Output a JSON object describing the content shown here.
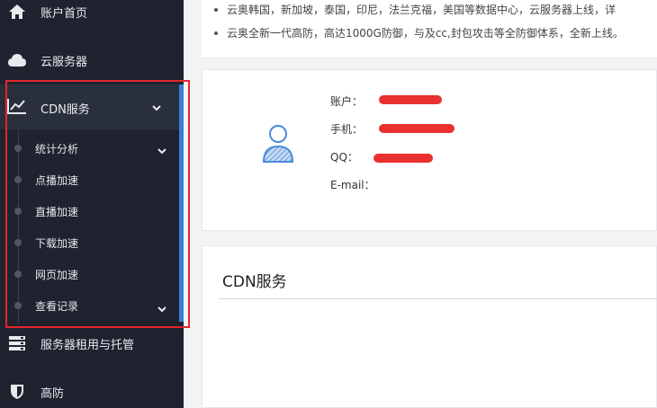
{
  "sidebar": {
    "items": [
      {
        "label": "账户首页",
        "icon": "home-icon"
      },
      {
        "label": "云服务器",
        "icon": "cloud-icon"
      },
      {
        "label": "CDN服务",
        "icon": "chart-line-icon",
        "expanded": true
      },
      {
        "label": "服务器租用与托管",
        "icon": "server-icon"
      },
      {
        "label": "高防",
        "icon": "shield-icon"
      }
    ],
    "cdn_submenu": [
      {
        "label": "统计分析",
        "has_children": true
      },
      {
        "label": "点播加速",
        "has_children": false
      },
      {
        "label": "直播加速",
        "has_children": false
      },
      {
        "label": "下载加速",
        "has_children": false
      },
      {
        "label": "网页加速",
        "has_children": false
      },
      {
        "label": "查看记录",
        "has_children": true
      }
    ]
  },
  "notice": {
    "lines": [
      "云奥韩国，新加坡，泰国，印尼，法兰克福，美国等数据中心，云服务器上线，详",
      "云奥全新一代高防，高达1000G防御，与及cc,封包攻击等全防御体系，全新上线。"
    ]
  },
  "account": {
    "account_label": "账户：",
    "phone_label": "手机：",
    "qq_label": "QQ：",
    "email_label": "E-mail："
  },
  "cdn_panel": {
    "title": "CDN服务"
  },
  "colors": {
    "sidebar_bg": "#1f2330",
    "accent_blue": "#3a7fd5",
    "highlight_red": "#e5262a"
  }
}
